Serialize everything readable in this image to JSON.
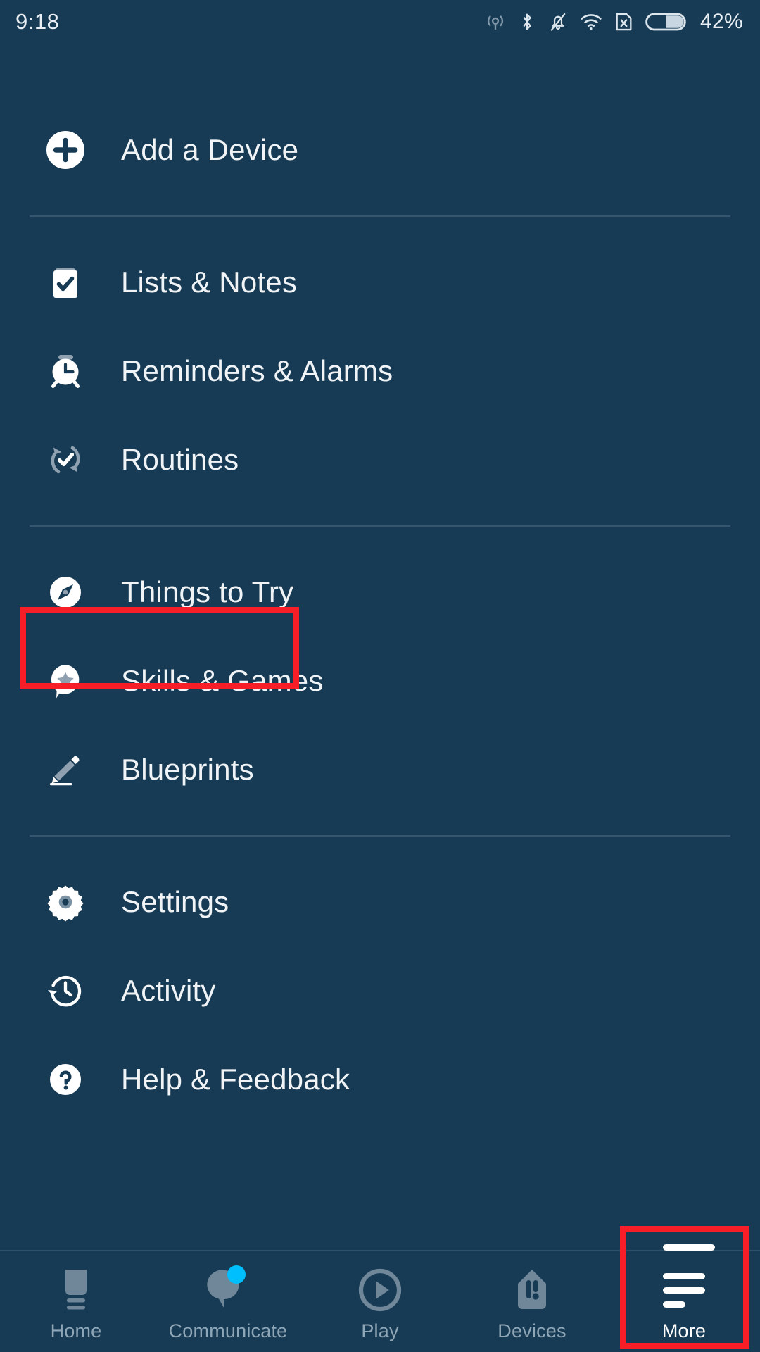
{
  "status_bar": {
    "time": "9:18",
    "battery_percent": "42%",
    "icons": [
      {
        "name": "cast-icon"
      },
      {
        "name": "bluetooth-icon"
      },
      {
        "name": "notifications-muted-icon"
      },
      {
        "name": "wifi-icon"
      },
      {
        "name": "no-sim-icon"
      },
      {
        "name": "battery-icon"
      }
    ]
  },
  "colors": {
    "background": "#173b54",
    "highlight": "#f81e28",
    "accent_badge": "#00bfff",
    "text_primary": "#f1f4f7",
    "text_muted": "#8fa6b7",
    "icon_muted": "#8fa1b0",
    "divider": "#35566d"
  },
  "menu": {
    "groups": [
      {
        "items": [
          {
            "label": "Add a Device",
            "icon": "add-circle-icon",
            "highlighted": false
          }
        ]
      },
      {
        "items": [
          {
            "label": "Lists & Notes",
            "icon": "clipboard-check-icon",
            "highlighted": false
          },
          {
            "label": "Reminders & Alarms",
            "icon": "alarm-clock-icon",
            "highlighted": false
          },
          {
            "label": "Routines",
            "icon": "routine-refresh-check-icon",
            "highlighted": false
          }
        ]
      },
      {
        "items": [
          {
            "label": "Things to Try",
            "icon": "compass-icon",
            "highlighted": false
          },
          {
            "label": "Skills & Games",
            "icon": "speech-bubble-star-icon",
            "highlighted": true
          },
          {
            "label": "Blueprints",
            "icon": "pencil-icon",
            "highlighted": false
          }
        ]
      },
      {
        "items": [
          {
            "label": "Settings",
            "icon": "gear-icon",
            "highlighted": false
          },
          {
            "label": "Activity",
            "icon": "clock-history-icon",
            "highlighted": false
          },
          {
            "label": "Help & Feedback",
            "icon": "help-circle-icon",
            "highlighted": false
          }
        ]
      }
    ]
  },
  "bottom_nav": {
    "items": [
      {
        "label": "Home",
        "icon": "echo-device-icon",
        "active": false,
        "badge": false
      },
      {
        "label": "Communicate",
        "icon": "speech-bubble-icon",
        "active": false,
        "badge": true
      },
      {
        "label": "Play",
        "icon": "play-circle-icon",
        "active": false,
        "badge": false
      },
      {
        "label": "Devices",
        "icon": "devices-icon",
        "active": false,
        "badge": false
      },
      {
        "label": "More",
        "icon": "hamburger-menu-icon",
        "active": true,
        "badge": false,
        "highlighted": true
      }
    ]
  }
}
